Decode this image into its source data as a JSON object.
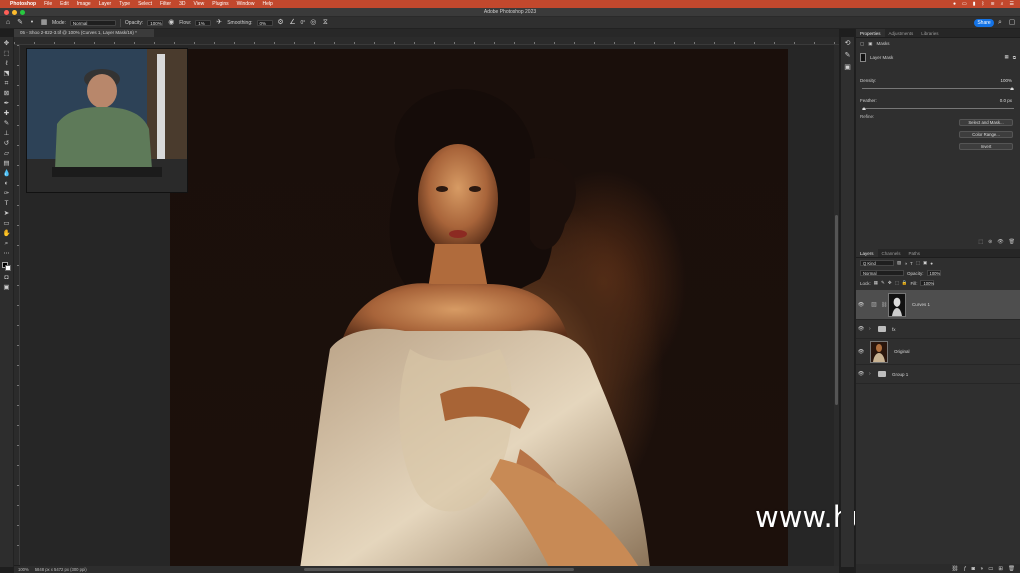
{
  "menubar": {
    "app_name": "Photoshop",
    "items": [
      "File",
      "Edit",
      "Image",
      "Layer",
      "Type",
      "Select",
      "Filter",
      "3D",
      "View",
      "Plugins",
      "Window",
      "Help"
    ]
  },
  "titlebar": {
    "title": "Adobe Photoshop 2023"
  },
  "options_bar": {
    "mode_label": "Mode:",
    "mode_value": "Normal",
    "opacity_label": "Opacity:",
    "opacity_value": "100%",
    "flow_label": "Flow:",
    "flow_value": "1%",
    "smoothing_label": "Smoothing:",
    "smoothing_value": "0%",
    "angle_value": "0°",
    "share_label": "Share"
  },
  "document": {
    "tab_title": "05 - Shoo 2-822-3.tif @ 100% (Curves 1, Layer Mask/16) *"
  },
  "status": {
    "zoom": "100%",
    "doc_size": "5848 px x 5472 px (300 ppi)"
  },
  "watermark": {
    "text": "www.hunls.com"
  },
  "properties": {
    "tabs": [
      "Properties",
      "Adjustments",
      "Libraries"
    ],
    "masks_label": "Masks",
    "layer_mask_label": "Layer Mask",
    "density_label": "Density:",
    "density_value": "100%",
    "density_fraction": 1.0,
    "feather_label": "Feather:",
    "feather_value": "0.0 px",
    "feather_fraction": 0.0,
    "refine_label": "Refine:",
    "buttons": [
      "Select and Mask...",
      "Color Range...",
      "Invert"
    ]
  },
  "layers": {
    "tabs": [
      "Layers",
      "Channels",
      "Paths"
    ],
    "kind_label": "Q Kind",
    "blend_mode": "Normal",
    "opacity_label": "Opacity:",
    "opacity_value": "100%",
    "lock_label": "Lock:",
    "fill_label": "Fill:",
    "fill_value": "100%",
    "rows": [
      {
        "name": "Curves 1",
        "type": "adjustment",
        "selected": true
      },
      {
        "name": "fx",
        "type": "group",
        "selected": false
      },
      {
        "name": "Original",
        "type": "pixel",
        "selected": false
      },
      {
        "name": "Group 1",
        "type": "group",
        "selected": false
      }
    ]
  },
  "colors": {
    "menubar": "#c2482d",
    "accent": "#1473e6",
    "panel_bg": "#2f2f2f",
    "selected_row": "#4e4e4e"
  }
}
